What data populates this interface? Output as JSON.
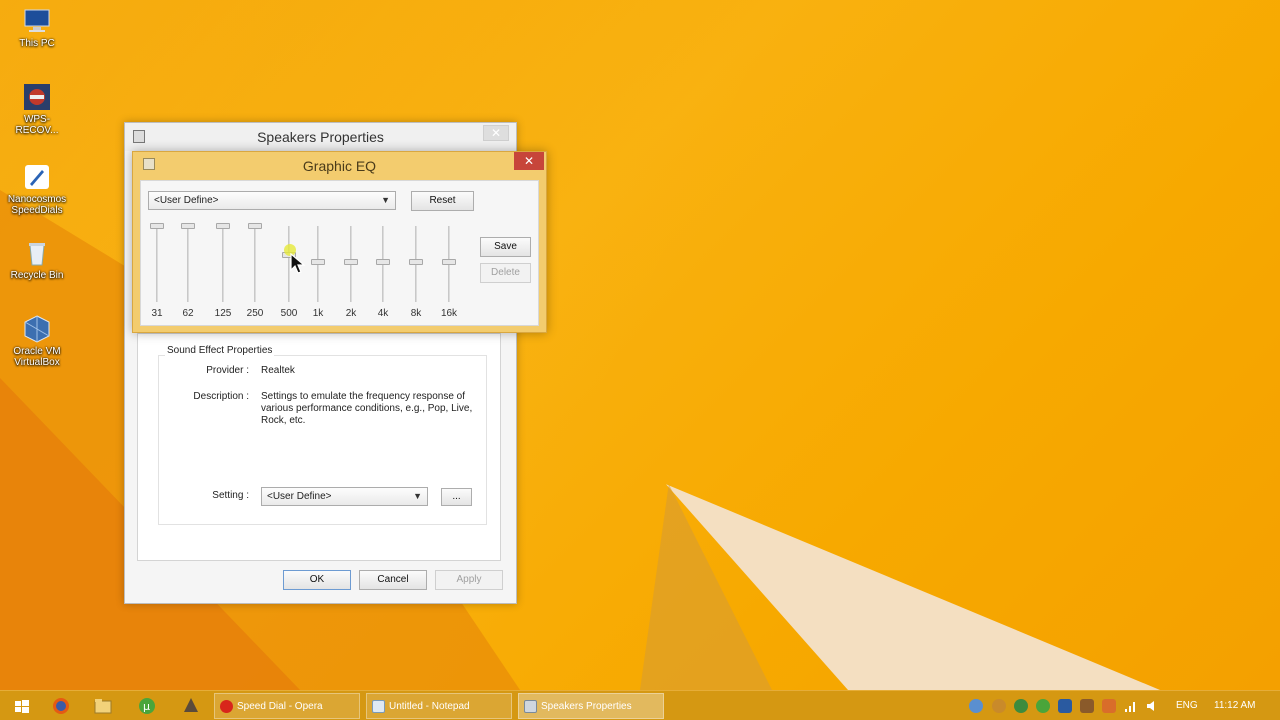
{
  "desktop": {
    "icons": [
      {
        "label": "This PC"
      },
      {
        "label": "WPS-RECOV..."
      },
      {
        "label": "Nanocosmos SpeedDials"
      },
      {
        "label": "Recycle Bin"
      },
      {
        "label": "Oracle VM VirtualBox"
      }
    ]
  },
  "speakers_window": {
    "title": "Speakers Properties",
    "section_label": "Sound Effect Properties",
    "provider_label": "Provider :",
    "provider_value": "Realtek",
    "description_label": "Description :",
    "description_value": "Settings to emulate the frequency response of various performance conditions,  e.g., Pop, Live, Rock, etc.",
    "setting_label": "Setting :",
    "setting_value": "<User Define>",
    "ellipsis_button": "...",
    "ok_button": "OK",
    "cancel_button": "Cancel",
    "apply_button": "Apply"
  },
  "eq_window": {
    "title": "Graphic EQ",
    "preset_value": "<User Define>",
    "reset_button": "Reset",
    "save_button": "Save",
    "delete_button": "Delete",
    "bands": [
      {
        "freq": "31",
        "level": 0
      },
      {
        "freq": "62",
        "level": 0
      },
      {
        "freq": "125",
        "level": 0
      },
      {
        "freq": "250",
        "level": 0
      },
      {
        "freq": "500",
        "level": 0.4
      },
      {
        "freq": "1k",
        "level": 0.5
      },
      {
        "freq": "2k",
        "level": 0.5
      },
      {
        "freq": "4k",
        "level": 0.5
      },
      {
        "freq": "8k",
        "level": 0.5
      },
      {
        "freq": "16k",
        "level": 0.5
      }
    ]
  },
  "taskbar": {
    "tasks": [
      {
        "label": "Speed Dial - Opera"
      },
      {
        "label": "Untitled - Notepad"
      },
      {
        "label": "Speakers Properties"
      }
    ],
    "language": "ENG",
    "clock": "11:12 AM"
  },
  "colors": {
    "desktop_bg": "#f6a800",
    "eq_frame": "#f3cc6e",
    "close_red": "#c7453a"
  }
}
